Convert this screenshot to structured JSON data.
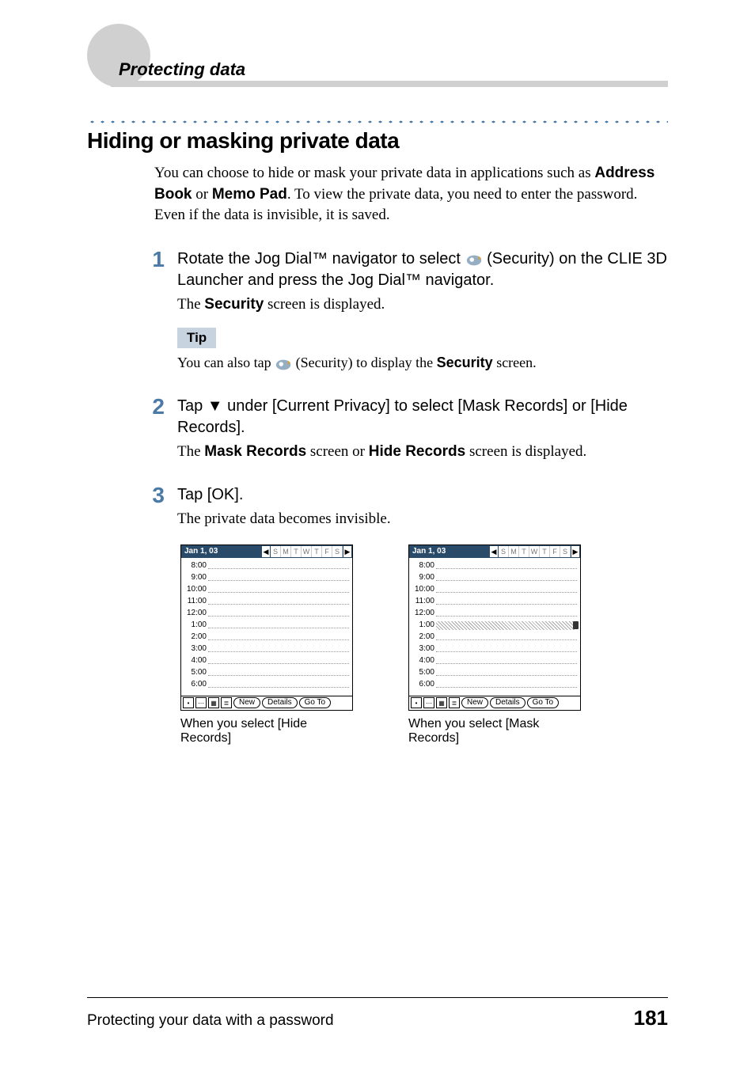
{
  "header": {
    "title": "Protecting data"
  },
  "heading": "Hiding or masking private data",
  "intro": {
    "part1": "You can choose to hide or mask your private data in applications such as ",
    "bold1": "Address Book",
    "part2": " or ",
    "bold2": "Memo Pad",
    "part3": ". To view the private data, you need to enter the password. Even if the data is invisible, it is saved."
  },
  "steps": [
    {
      "num": "1",
      "main_before_icon": "Rotate the Jog Dial™ navigator to select ",
      "main_after_icon": " (Security) on the CLIE 3D Launcher and press the Jog Dial™ navigator.",
      "sub_before_bold": "The ",
      "sub_bold": "Security",
      "sub_after_bold": " screen is displayed.",
      "tip_label": "Tip",
      "tip_before_icon": "You can also tap ",
      "tip_after_icon": " (Security) to display the ",
      "tip_bold": "Security",
      "tip_end": " screen."
    },
    {
      "num": "2",
      "main": "Tap ▼ under [Current Privacy] to select [Mask Records] or [Hide Records].",
      "sub_before_bold1": "The ",
      "sub_bold1": "Mask Records",
      "sub_mid": " screen or ",
      "sub_bold2": "Hide Records",
      "sub_end": " screen is displayed."
    },
    {
      "num": "3",
      "main": "Tap [OK].",
      "sub": "The private data becomes invisible."
    }
  ],
  "palm": {
    "date": "Jan 1, 03",
    "days": [
      "S",
      "M",
      "T",
      "W",
      "T",
      "F",
      "S"
    ],
    "times": [
      "8:00",
      "9:00",
      "10:00",
      "11:00",
      "12:00",
      "1:00",
      "2:00",
      "3:00",
      "4:00",
      "5:00",
      "6:00"
    ],
    "masked_index": 5,
    "buttons": {
      "new": "New",
      "details": "Details",
      "goto": "Go To"
    }
  },
  "captions": {
    "left": "When you select [Hide Records]",
    "right": "When you select [Mask Records]"
  },
  "footer": {
    "left": "Protecting your data with a password",
    "page": "181"
  }
}
